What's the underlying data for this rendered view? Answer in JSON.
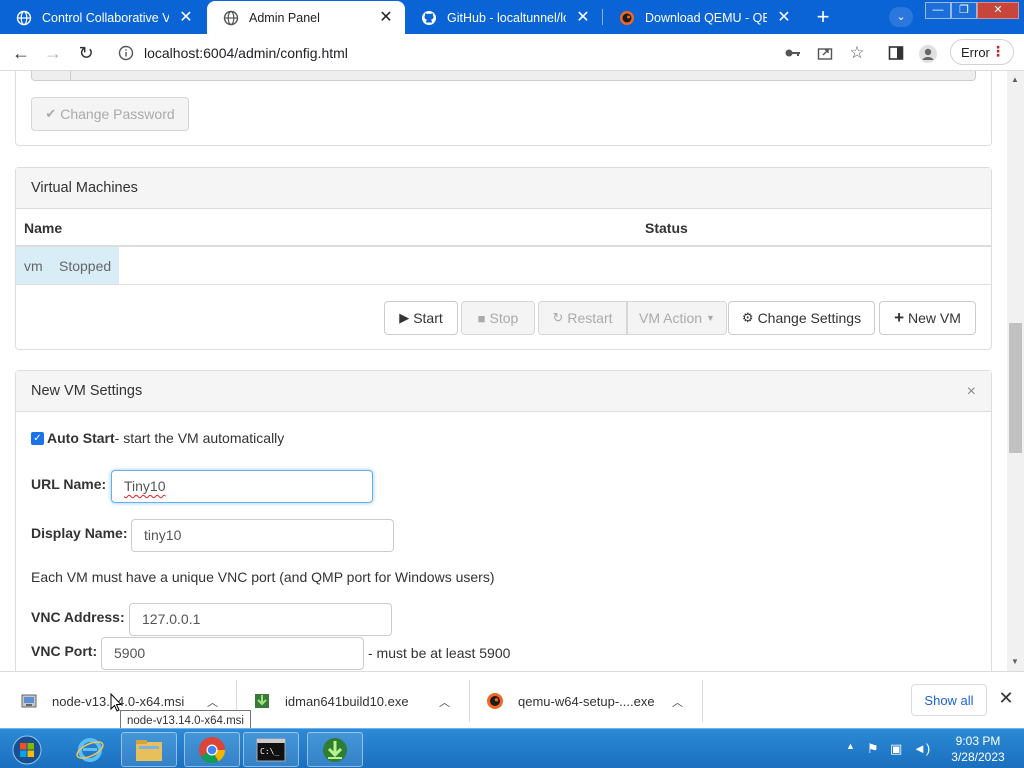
{
  "browser": {
    "tabs": [
      {
        "title": "Control Collaborative Vir",
        "active": false,
        "favicon": "globe-icon"
      },
      {
        "title": "Admin Panel",
        "active": true,
        "favicon": "globe-icon"
      },
      {
        "title": "GitHub - localtunnel/loca",
        "active": false,
        "favicon": "github-icon"
      },
      {
        "title": "Download QEMU - QEMU",
        "active": false,
        "favicon": "qemu-icon"
      }
    ],
    "url": "localhost:6004/admin/config.html",
    "error_label": "Error"
  },
  "page": {
    "change_password_label": "Change Password",
    "vm_panel": {
      "title": "Virtual Machines",
      "columns": [
        "Name",
        "Status"
      ],
      "rows": [
        {
          "name": "vm",
          "status": "Stopped"
        }
      ],
      "buttons": {
        "start": "Start",
        "stop": "Stop",
        "restart": "Restart",
        "vm_action": "VM Action",
        "change_settings": "Change Settings",
        "new_vm": "New VM"
      }
    },
    "new_vm_panel": {
      "title": "New VM Settings",
      "close": "×",
      "auto_start": {
        "label": "Auto Start",
        "description": " - start the VM automatically",
        "checked": true
      },
      "url_name": {
        "label": "URL Name:",
        "value": "Tiny10"
      },
      "display_name": {
        "label": "Display Name:",
        "value": "tiny10"
      },
      "note": "Each VM must have a unique VNC port (and QMP port for Windows users)",
      "vnc_address": {
        "label": "VNC Address:",
        "value": "127.0.0.1"
      },
      "vnc_port": {
        "label": "VNC Port:",
        "value": "5900",
        "hint": "- must be at least 5900"
      }
    }
  },
  "downloads": {
    "items": [
      {
        "name": "node-v13.14.0-x64.msi",
        "icon": "msi-installer-icon"
      },
      {
        "name": "idman641build10.exe",
        "icon": "idm-installer-icon"
      },
      {
        "name": "qemu-w64-setup-....exe",
        "icon": "qemu-installer-icon"
      }
    ],
    "show_all": "Show all",
    "tooltip": "node-v13.14.0-x64.msi"
  },
  "taskbar": {
    "time": "9:03 PM",
    "date": "3/28/2023",
    "apps": [
      "internet-explorer-icon",
      "file-explorer-icon",
      "chrome-icon",
      "cmd-icon",
      "idm-icon"
    ]
  }
}
